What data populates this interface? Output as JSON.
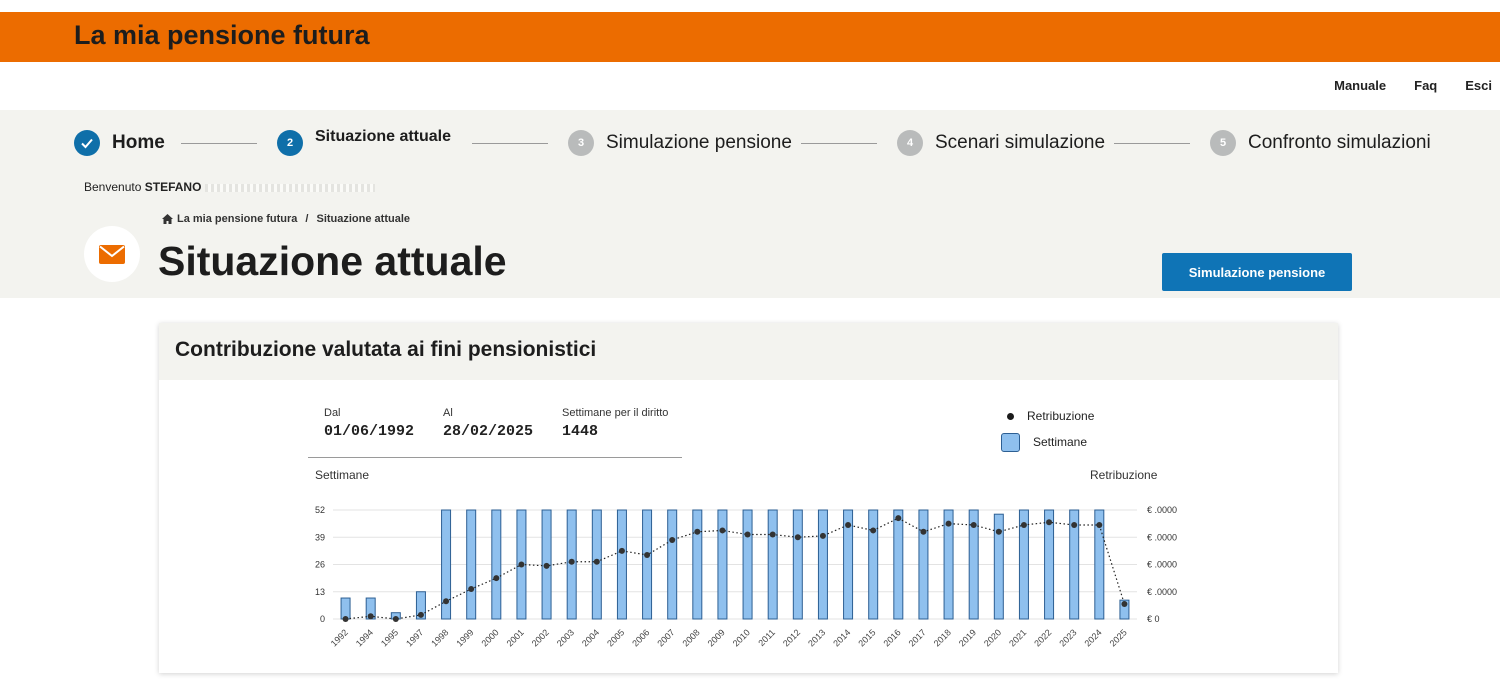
{
  "app": {
    "title": "La mia pensione futura"
  },
  "utility_nav": [
    "Manuale",
    "Faq",
    "Esci"
  ],
  "steps": [
    {
      "num": "",
      "label": "Home",
      "state": "done"
    },
    {
      "num": "2",
      "label": "Situazione attuale",
      "state": "active"
    },
    {
      "num": "3",
      "label": "Simulazione pensione",
      "state": "todo"
    },
    {
      "num": "4",
      "label": "Scenari simulazione",
      "state": "todo"
    },
    {
      "num": "5",
      "label": "Confronto simulazioni",
      "state": "todo"
    }
  ],
  "welcome": {
    "prefix": "Benvenuto",
    "user": "STEFANO"
  },
  "breadcrumb": {
    "home": "La mia pensione futura",
    "sep": "/",
    "current": "Situazione attuale"
  },
  "page": {
    "title": "Situazione attuale",
    "action_button": "Simulazione pensione"
  },
  "card": {
    "title": "Contribuzione valutata ai fini pensionistici",
    "dal_label": "Dal",
    "dal_value": "01/06/1992",
    "al_label": "Al",
    "al_value": "28/02/2025",
    "settimane_label": "Settimane per il diritto",
    "settimane_value": "1448",
    "legend_retribuzione": "Retribuzione",
    "legend_settimane": "Settimane",
    "left_axis_label": "Settimane",
    "right_axis_label": "Retribuzione"
  },
  "colors": {
    "brand": "#ec6c00",
    "primary": "#0f74b6",
    "bar_fill": "#8fc0ee",
    "bar_stroke": "#2d5f93"
  },
  "chart_data": {
    "type": "bar",
    "categories": [
      "1992",
      "1994",
      "1995",
      "1997",
      "1998",
      "1999",
      "2000",
      "2001",
      "2002",
      "2003",
      "2004",
      "2005",
      "2006",
      "2007",
      "2008",
      "2009",
      "2010",
      "2011",
      "2012",
      "2013",
      "2014",
      "2015",
      "2016",
      "2017",
      "2018",
      "2019",
      "2020",
      "2021",
      "2022",
      "2023",
      "2024",
      "2025"
    ],
    "series": [
      {
        "name": "Settimane",
        "type": "bar",
        "axis": "left",
        "values": [
          10,
          10,
          3,
          13,
          52,
          52,
          52,
          52,
          52,
          52,
          52,
          52,
          52,
          52,
          52,
          52,
          52,
          52,
          52,
          52,
          52,
          52,
          52,
          52,
          52,
          52,
          50,
          52,
          52,
          52,
          52,
          9
        ]
      },
      {
        "name": "Retribuzione",
        "type": "line",
        "axis": "right",
        "values": [
          0,
          0.2,
          0,
          0.3,
          1.3,
          2.2,
          3.0,
          4.0,
          3.9,
          4.2,
          4.2,
          5.0,
          4.7,
          5.8,
          6.4,
          6.5,
          6.2,
          6.2,
          6.0,
          6.1,
          6.9,
          6.5,
          7.4,
          6.4,
          7.0,
          6.9,
          6.4,
          6.9,
          7.1,
          6.9,
          6.9,
          1.1
        ]
      }
    ],
    "left_ticks": [
      "0",
      "13",
      "26",
      "39",
      "52"
    ],
    "right_ticks": [
      "€ 0",
      "€ .0000",
      "€ .0000",
      "€ .0000",
      "€ .0000"
    ],
    "ylim_left": [
      0,
      52
    ],
    "ylim_right": [
      0,
      8
    ],
    "legend_position": "top-right"
  }
}
